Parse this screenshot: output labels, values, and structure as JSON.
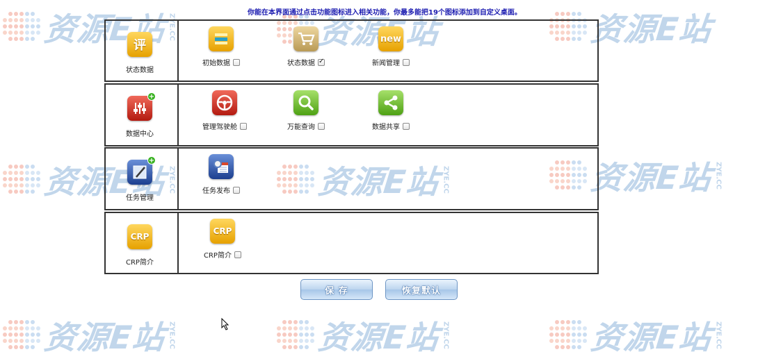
{
  "header": {
    "text": "你能在本界面通过点击功能图标进入相关功能，你最多能把19个图标添加到自定义桌面。"
  },
  "watermark": {
    "text": "资源E站",
    "sub": "ZYE.CC"
  },
  "sections": [
    {
      "category": {
        "label": "状态数据",
        "icon": "comment-icon",
        "glyph": "评",
        "color": "yellow"
      },
      "items": [
        {
          "label": "初始数据",
          "icon": "stack-icon",
          "color": "yellow",
          "checked": false
        },
        {
          "label": "状态数据",
          "icon": "cart-icon",
          "color": "tan",
          "checked": true
        },
        {
          "label": "新闻管理",
          "icon": "new-icon",
          "glyph": "new",
          "color": "yellow",
          "checked": false
        }
      ]
    },
    {
      "category": {
        "label": "数据中心",
        "icon": "equalizer-icon",
        "color": "red"
      },
      "items": [
        {
          "label": "管理驾驶舱",
          "icon": "steering-wheel-icon",
          "color": "red",
          "checked": false
        },
        {
          "label": "万能查询",
          "icon": "magnifier-icon",
          "color": "green",
          "checked": false
        },
        {
          "label": "数据共享",
          "icon": "share-icon",
          "color": "green",
          "checked": false
        }
      ]
    },
    {
      "category": {
        "label": "任务管理",
        "icon": "task-pen-icon",
        "color": "blue"
      },
      "items": [
        {
          "label": "任务发布",
          "icon": "calendar-gear-icon",
          "color": "blue",
          "checked": false
        }
      ]
    },
    {
      "category": {
        "label": "CRP简介",
        "icon": "crp-icon",
        "glyph": "CRP",
        "color": "yellow"
      },
      "items": [
        {
          "label": "CRP简介",
          "icon": "crp-icon",
          "glyph": "CRP",
          "color": "yellow",
          "checked": false
        }
      ]
    }
  ],
  "buttons": {
    "save": "保  存",
    "restore": "恢复默认"
  }
}
